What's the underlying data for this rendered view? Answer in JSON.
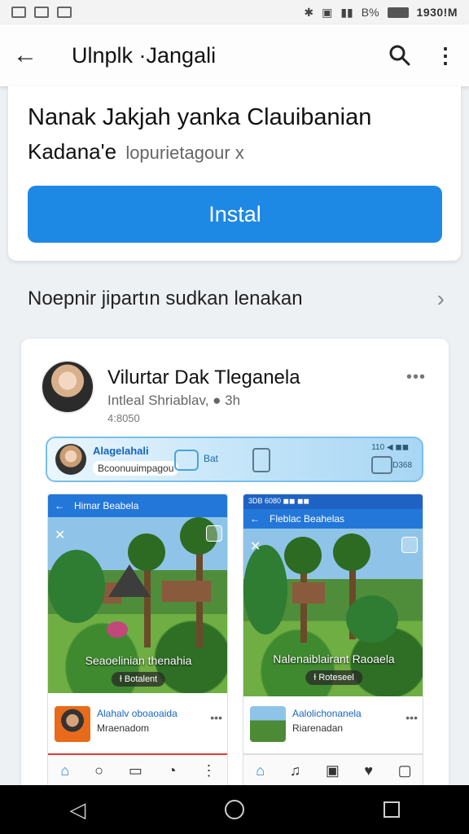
{
  "status_bar": {
    "battery": "B%",
    "time": "1930!M"
  },
  "app_bar": {
    "title": "Ulnplk ·Jangali"
  },
  "top_card": {
    "headline": "Nanak Jakjah yanka Clauibanian",
    "name": "Kadana'e",
    "subtitle": "lopurietagour x",
    "install_label": "Instal"
  },
  "section": {
    "title": "Noepnir jipartın sudkan lenakan"
  },
  "post": {
    "author": "Vilurtar Dak Tleganela",
    "meta": "Intleal Shriablav, ● 3h",
    "time": "4:8050",
    "more": "•••",
    "banner": {
      "name": "Alagelahali",
      "sub": "Bcoonuuimpagou",
      "tag": "Bat",
      "status": "110 ◀ ◼◼",
      "count": "D368"
    },
    "phones": [
      {
        "status": "",
        "bar_title": "Himar Beabela",
        "photo_title": "Seaoelinian thenahia",
        "photo_chip": "Ɨ Botalent",
        "row_name": "Alahalv oboaoaida",
        "row_sub": "Mraenadom",
        "row_more": "•••"
      },
      {
        "status": "3DB 6080 ◼◼ ◼◼",
        "bar_title": "Fleblac Beahelas",
        "photo_title": "Nalenaiblairant Raoaela",
        "photo_chip": "Ɨ Roteseel",
        "row_name": "Aalolichonanela",
        "row_sub": "Riarenadan",
        "row_more": "•••"
      }
    ]
  },
  "icons": {
    "back": "arrow-left",
    "search": "magnifier",
    "more": "vertical-dots",
    "chevron": "chevron-right"
  }
}
